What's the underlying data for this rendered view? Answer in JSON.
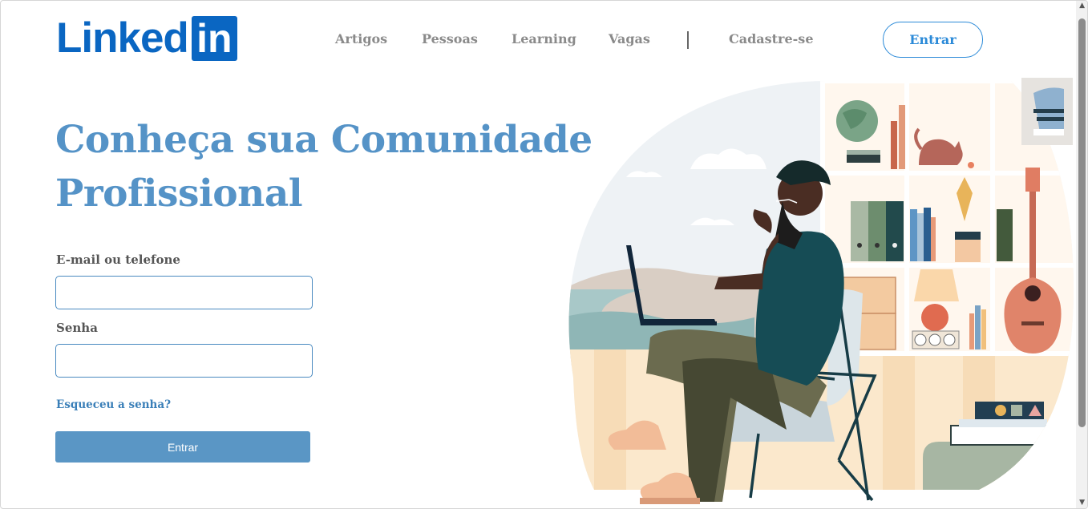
{
  "header": {
    "logo_word": "Linked",
    "logo_box": "in",
    "nav": {
      "artigos": "Artigos",
      "pessoas": "Pessoas",
      "learning": "Learning",
      "vagas": "Vagas",
      "cadastre": "Cadastre-se"
    },
    "entrar_label": "Entrar"
  },
  "hero": {
    "title_line1": "Conheça sua Comunidade",
    "title_line2": "Profissional"
  },
  "form": {
    "email_label": "E-mail ou telefone",
    "email_value": "",
    "password_label": "Senha",
    "password_value": "",
    "forgot_label": "Esqueceu a senha?",
    "submit_label": "Entrar"
  },
  "colors": {
    "brand": "#0a66c2",
    "title": "#5593c7",
    "submit": "#5a96c5"
  },
  "icons": {
    "scroll_up": "▲",
    "scroll_down": "▼"
  }
}
